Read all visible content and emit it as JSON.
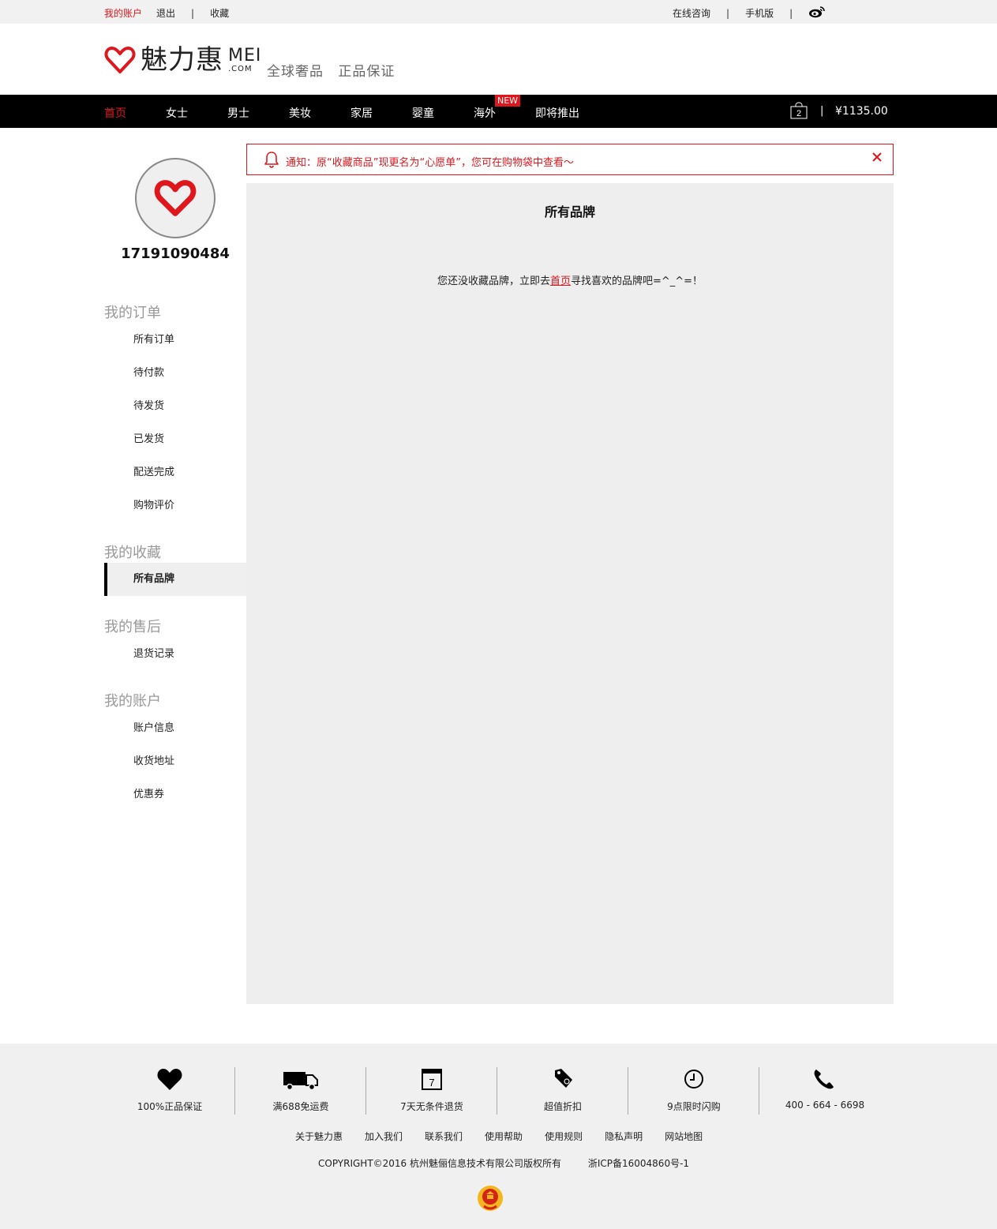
{
  "topbar": {
    "account": "我的账户",
    "logout": "退出",
    "sep": "|",
    "favorites": "收藏",
    "online_consult": "在线咨询",
    "mobile": "手机版"
  },
  "header": {
    "logo_cn": "魅力惠",
    "logo_en_big": "MEI",
    "logo_en_small": ".COM",
    "slogan1": "全球奢品",
    "slogan2": "正品保证"
  },
  "nav": {
    "items": [
      "首页",
      "女士",
      "男士",
      "美妆",
      "家居",
      "婴童",
      "海外",
      "即将推出"
    ],
    "new_badge": "NEW",
    "cart_count": "2",
    "cart_sep": "|",
    "cart_total": "¥1135.00"
  },
  "colors": {
    "accent": "#e0161d",
    "nav_bg": "#000000",
    "panel_bg": "#eeeeee"
  },
  "sidebar": {
    "username": "17191090484",
    "groups": [
      {
        "title": "我的订单",
        "items": [
          "所有订单",
          "待付款",
          "待发货",
          "已发货",
          "配送完成",
          "购物评价"
        ]
      },
      {
        "title": "我的收藏",
        "items": [
          "所有品牌"
        ]
      },
      {
        "title": "我的售后",
        "items": [
          "退货记录"
        ]
      },
      {
        "title": "我的账户",
        "items": [
          "账户信息",
          "收货地址",
          "优惠券"
        ]
      }
    ]
  },
  "notice": {
    "text": "通知：原“收藏商品”现更名为“心愿单”，您可在购物袋中查看～"
  },
  "main": {
    "title": "所有品牌",
    "empty_prefix": "您还没收藏品牌，立即去",
    "empty_link": "首页",
    "empty_suffix": "寻找喜欢的品牌吧=^_^=！"
  },
  "footer": {
    "features": [
      {
        "icon": "heart-icon",
        "label": "100%正品保证"
      },
      {
        "icon": "truck-icon",
        "label": "满688免运费"
      },
      {
        "icon": "calendar-icon",
        "label": "7天无条件退货",
        "num": "7"
      },
      {
        "icon": "tag-icon",
        "label": "超值折扣"
      },
      {
        "icon": "clock-icon",
        "label": "9点限时闪购"
      },
      {
        "icon": "phone-icon",
        "label": "400 - 664 - 6698"
      }
    ],
    "links": [
      "关于魅力惠",
      "加入我们",
      "联系我们",
      "使用帮助",
      "使用规则",
      "隐私声明",
      "网站地图"
    ],
    "copyright": "COPYRIGHT©2016 杭州魅俪信息技术有限公司版权所有",
    "icp": "浙ICP备16004860号-1"
  }
}
